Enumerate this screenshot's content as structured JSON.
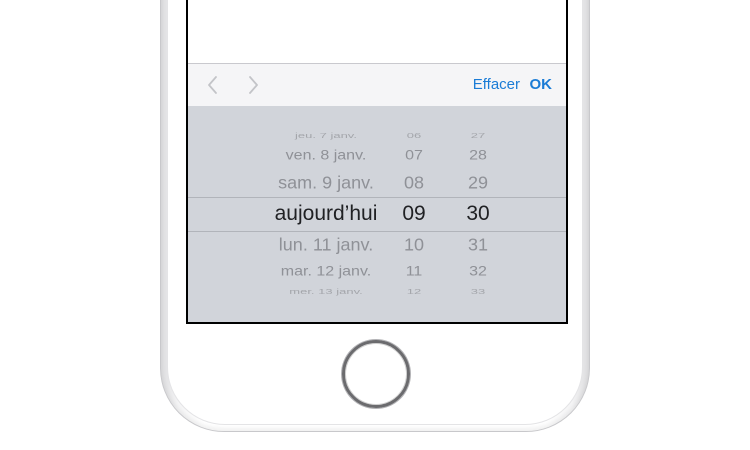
{
  "toolbar": {
    "prev_icon": "chevron-left-icon",
    "next_icon": "chevron-right-icon",
    "clear_label": "Effacer",
    "ok_label": "OK",
    "accent_color": "#1b7cd6"
  },
  "picker": {
    "rows": [
      {
        "day": "jeu. 7 janv.",
        "hour": "06",
        "minute": "27"
      },
      {
        "day": "ven. 8 janv.",
        "hour": "07",
        "minute": "28"
      },
      {
        "day": "sam. 9 janv.",
        "hour": "08",
        "minute": "29"
      },
      {
        "day": "aujourd’hui",
        "hour": "09",
        "minute": "30"
      },
      {
        "day": "lun. 11 janv.",
        "hour": "10",
        "minute": "31"
      },
      {
        "day": "mar. 12 janv.",
        "hour": "11",
        "minute": "32"
      },
      {
        "day": "mer. 13 janv.",
        "hour": "12",
        "minute": "33"
      }
    ],
    "selected_index": 3
  }
}
